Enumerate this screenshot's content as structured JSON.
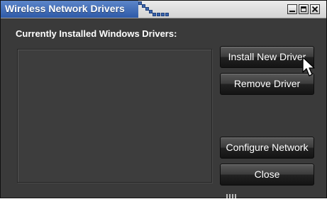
{
  "window": {
    "title": "Wireless Network Drivers"
  },
  "titlebar_buttons": {
    "minimize_icon": "minimize-icon",
    "maximize_icon": "maximize-icon",
    "close_icon": "close-icon"
  },
  "main": {
    "drivers_label": "Currently Installed Windows Drivers:",
    "drivers": []
  },
  "buttons": {
    "install": "Install New Driver",
    "remove": "Remove Driver",
    "configure": "Configure Network",
    "close": "Close"
  },
  "colors": {
    "title_bar_accent": "#3a68b3",
    "window_background": "#3a3a3a",
    "button_text": "#ffffff"
  }
}
